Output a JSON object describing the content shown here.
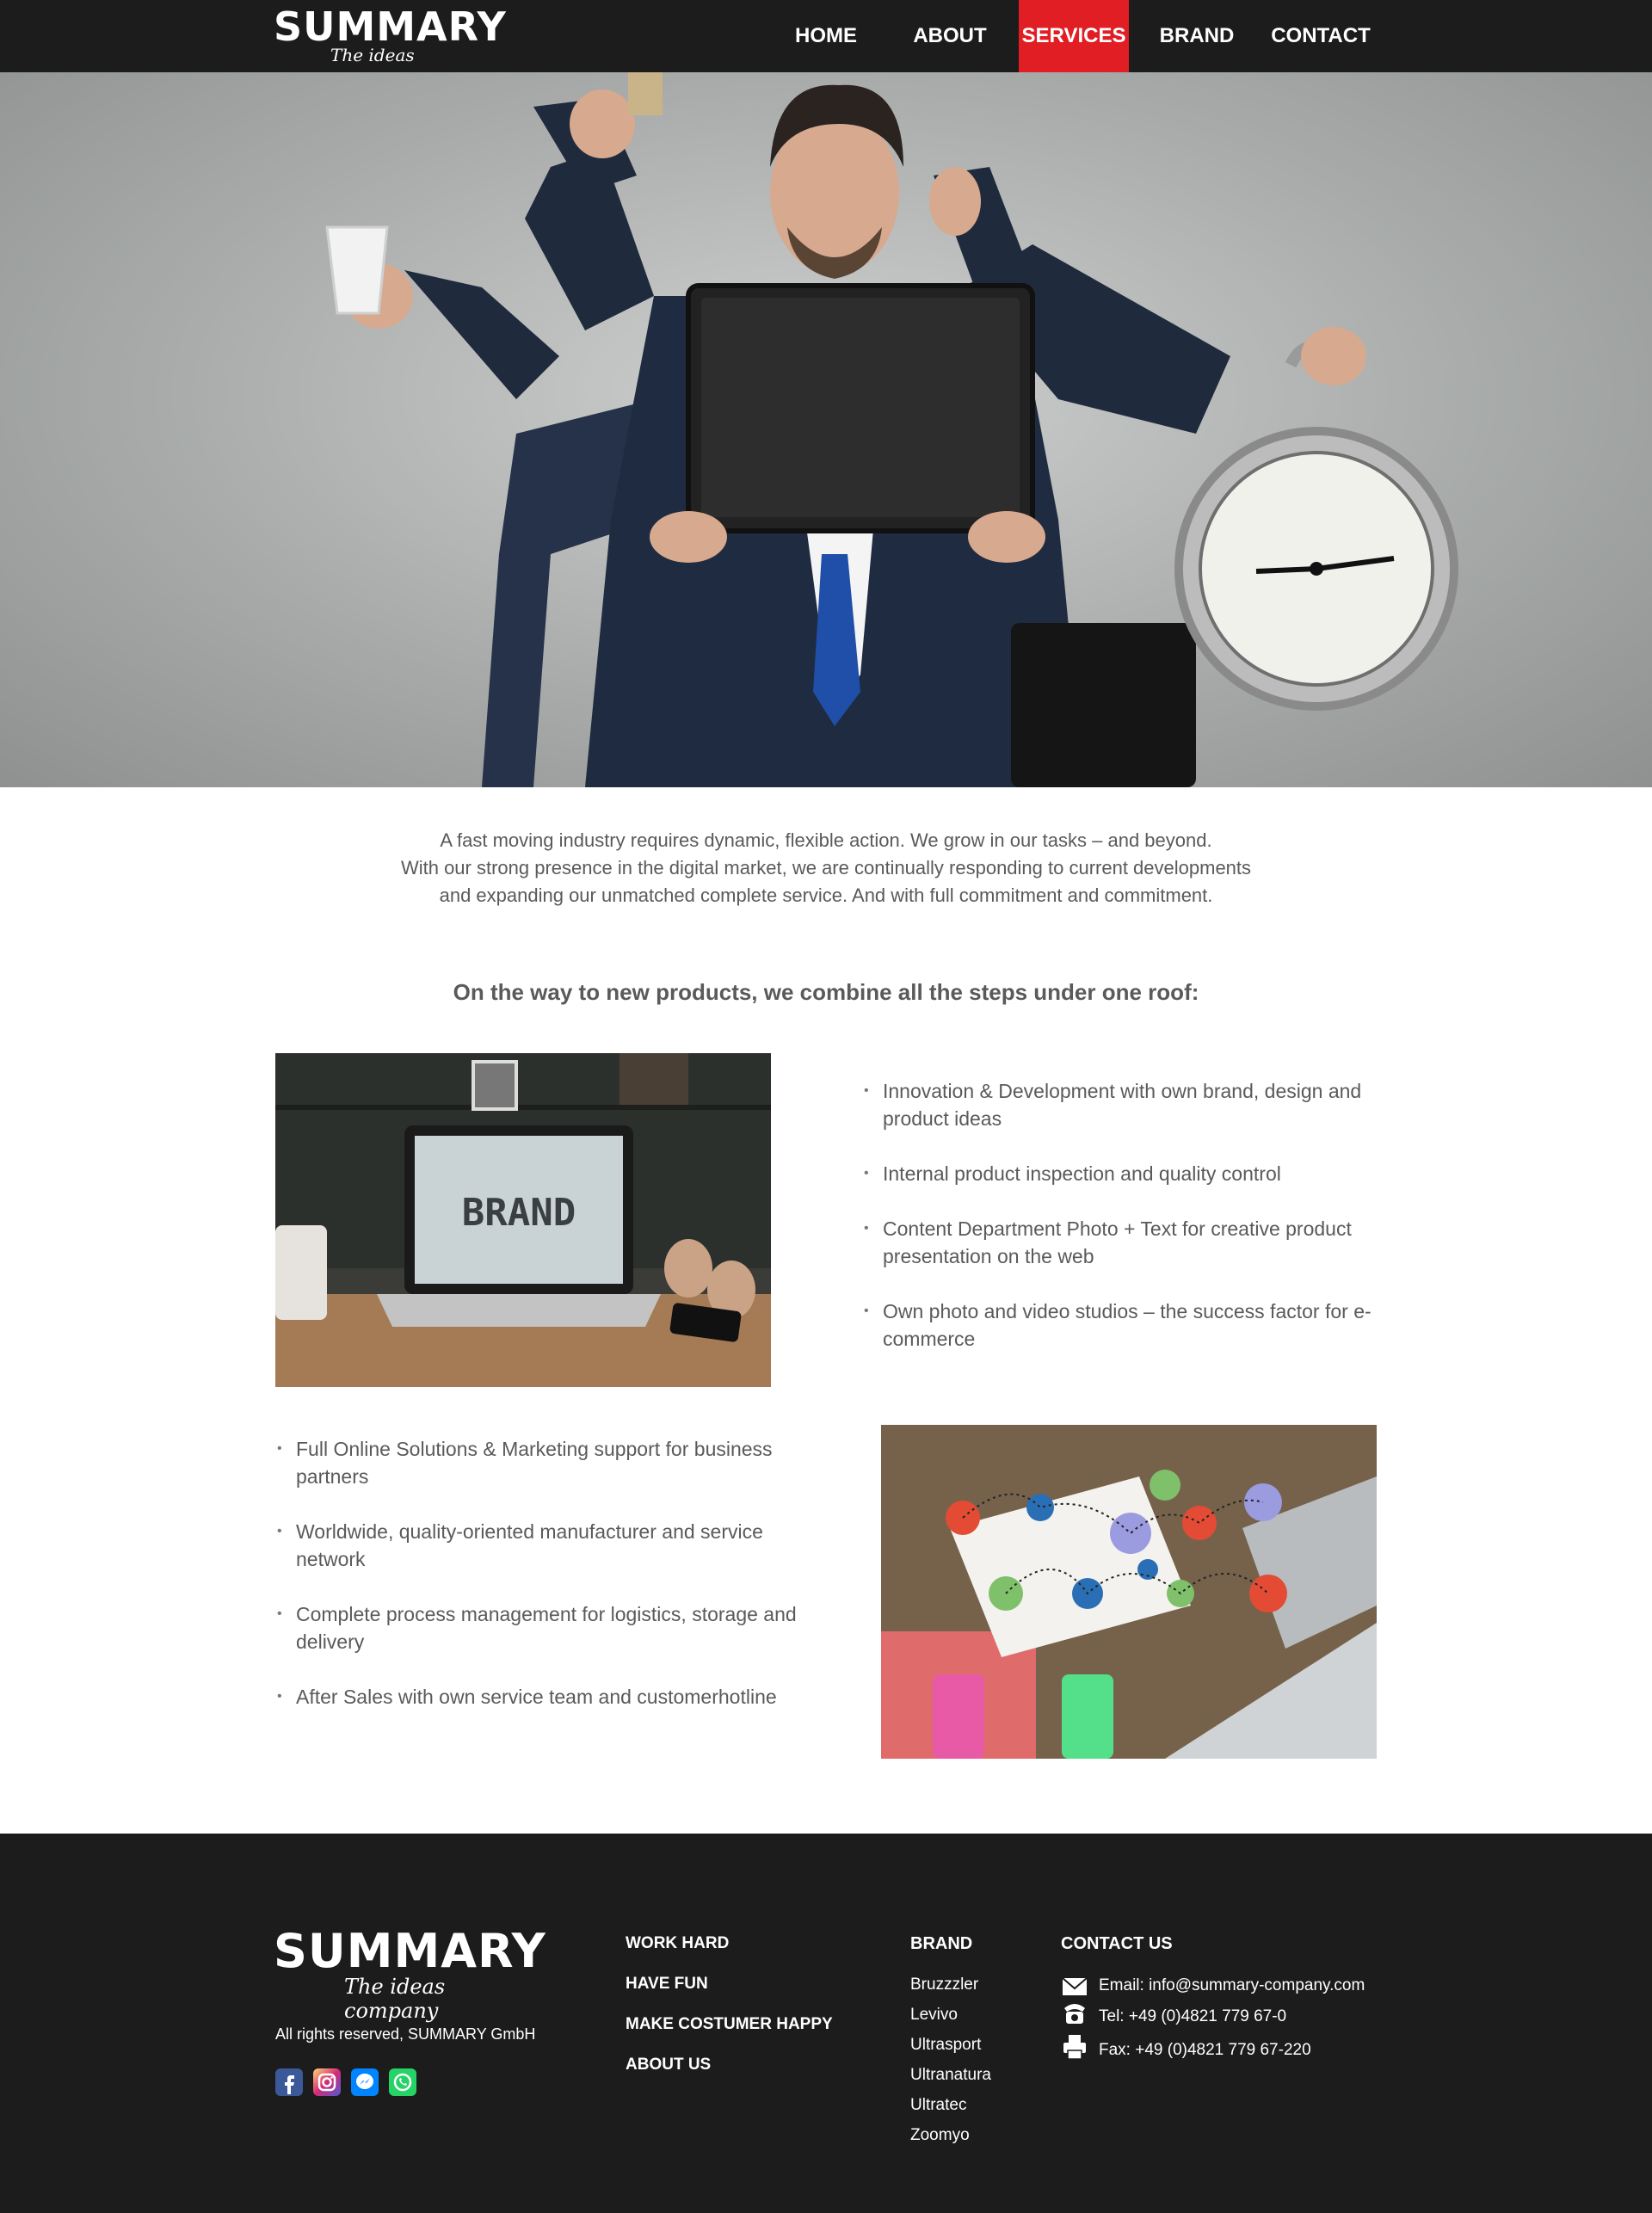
{
  "nav": {
    "logo_text": "SUMMARY",
    "logo_tagline": "The ideas company",
    "items": [
      {
        "label": "HOME",
        "active": false
      },
      {
        "label": "ABOUT",
        "active": false
      },
      {
        "label": "SERVICES",
        "active": true
      },
      {
        "label": "BRAND",
        "active": false
      },
      {
        "label": "CONTACT",
        "active": false
      }
    ]
  },
  "intro": {
    "line1": "A fast moving industry requires dynamic, flexible action. We grow in our tasks – and beyond.",
    "line2": "With our strong presence in the digital market, we are continually responding to current developments",
    "line3": "and expanding our unmatched complete service. And with full commitment and commitment."
  },
  "subheading": "On the way to new products, we combine all the steps under one roof:",
  "section1": {
    "image_text": "BRAND",
    "bullets": [
      "Innovation & Development with own brand, design and product ideas",
      "Internal product inspection and quality control",
      "Content Department Photo + Text for creative product presentation on the web",
      "Own photo and video studios – the success factor for e-commerce"
    ]
  },
  "section2": {
    "bullets": [
      "Full Online Solutions & Marketing support for business partners",
      "Worldwide, quality-oriented manufacturer and service network",
      "Complete process management for logistics, storage and delivery",
      "After Sales with own service team and customerhotline"
    ]
  },
  "footer": {
    "logo_text": "SUMMARY",
    "logo_tagline": "The ideas company",
    "rights": "All rights reserved, SUMMARY GmbH",
    "social": [
      {
        "icon": "facebook-icon",
        "color": "#3b5998"
      },
      {
        "icon": "instagram-icon",
        "color": "#e1306c"
      },
      {
        "icon": "messenger-icon",
        "color": "#0084ff"
      },
      {
        "icon": "whatsapp-icon",
        "color": "#25d366"
      }
    ],
    "links": [
      "WORK HARD",
      "HAVE FUN",
      "MAKE COSTUMER HAPPY",
      "ABOUT US"
    ],
    "brand_title": "BRAND",
    "brands": [
      "Bruzzzler",
      "Levivo",
      "Ultrasport",
      "Ultranatura",
      "Ultratec",
      "Zoomyo"
    ],
    "contact_title": "CONTACT US",
    "email": "Email: info@summary-company.com",
    "tel": "Tel:  +49 (0)4821 779 67-0",
    "fax": "Fax: +49 (0)4821 779 67-220"
  },
  "colors": {
    "nav_bg": "#1c1c1c",
    "accent": "#e01e24",
    "text": "#5a5a5a"
  }
}
